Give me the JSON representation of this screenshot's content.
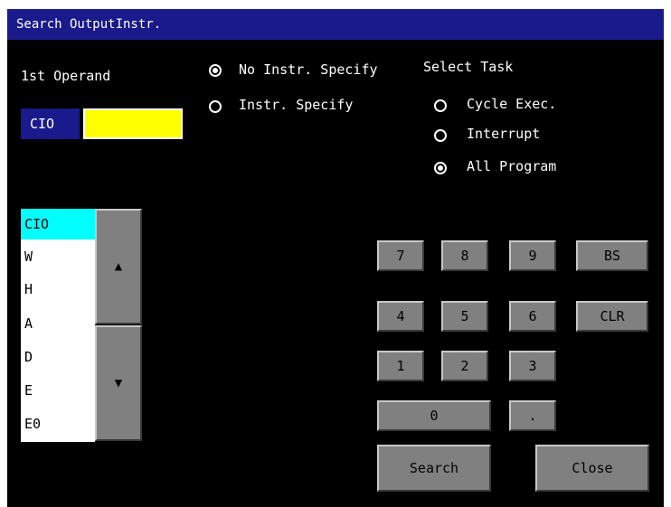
{
  "window": {
    "title": "Search OutputInstr."
  },
  "operand": {
    "label": "1st Operand",
    "area_label": "CIO",
    "value": ""
  },
  "instr_options": [
    {
      "label": "No Instr. Specify",
      "selected": true
    },
    {
      "label": "Instr. Specify",
      "selected": false
    }
  ],
  "task": {
    "label": "Select Task",
    "options": [
      {
        "label": "Cycle Exec.",
        "selected": false
      },
      {
        "label": "Interrupt",
        "selected": false
      },
      {
        "label": "All Program",
        "selected": true
      }
    ]
  },
  "area_list": {
    "items": [
      "CIO",
      "W",
      "H",
      "A",
      "D",
      "E",
      "E0"
    ],
    "selected_index": 0,
    "up_icon": "triangle-up-icon",
    "down_icon": "triangle-down-icon"
  },
  "keypad": {
    "k7": "7",
    "k8": "8",
    "k9": "9",
    "bs": "BS",
    "k4": "4",
    "k5": "5",
    "k6": "6",
    "clr": "CLR",
    "k1": "1",
    "k2": "2",
    "k3": "3",
    "k0": "0",
    "dot": "."
  },
  "actions": {
    "search": "Search",
    "close": "Close"
  },
  "colors": {
    "titlebar": "#1a1a8c",
    "field": "#ffff00",
    "selected_item": "#00ffff",
    "button": "#808080",
    "background": "#000000"
  }
}
